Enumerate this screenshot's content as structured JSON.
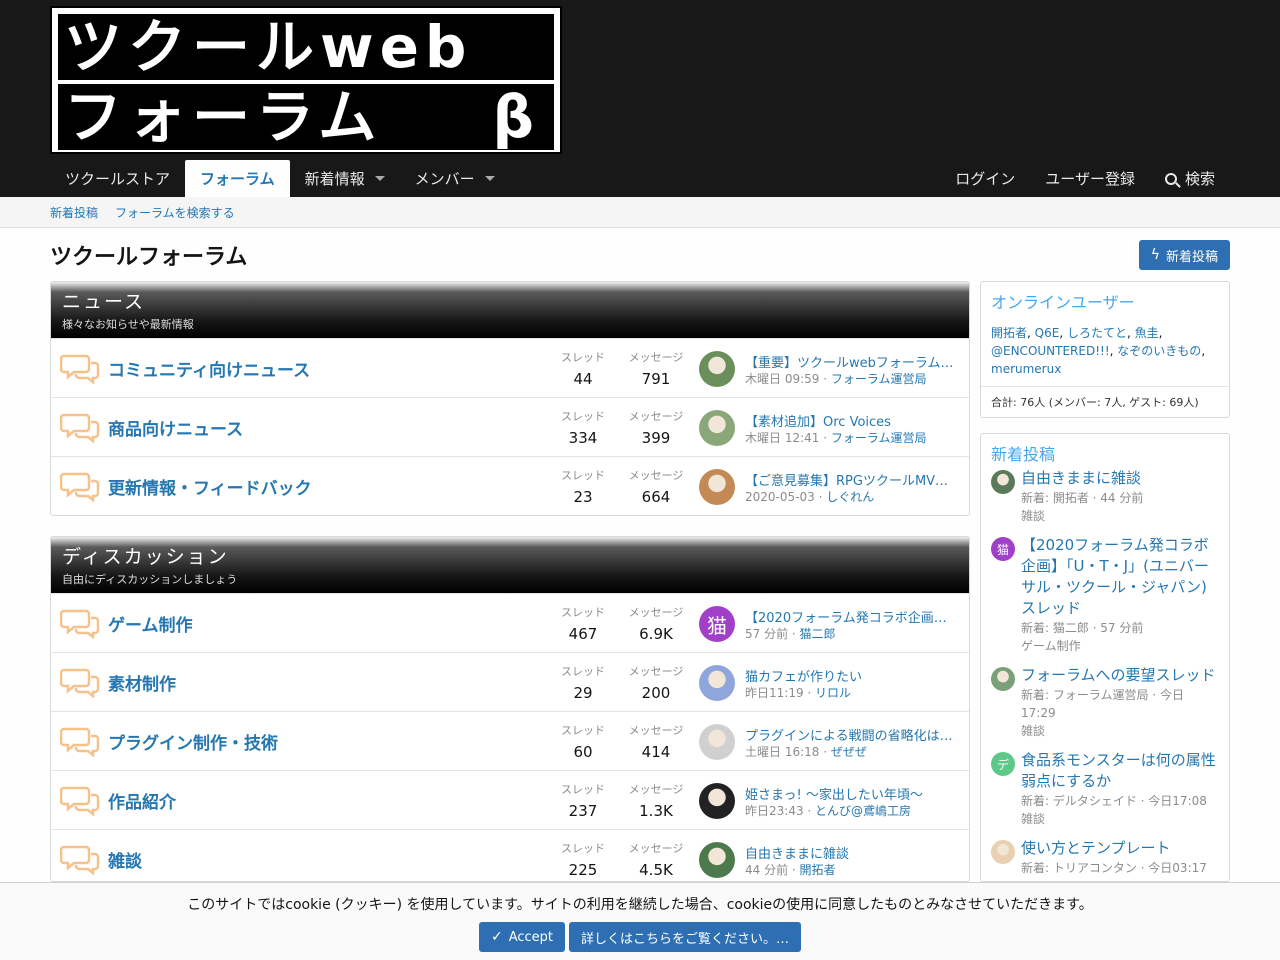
{
  "logo": {
    "line1": "ツクールweb",
    "line2": "フォーラム",
    "beta": "β"
  },
  "nav": {
    "items": [
      {
        "label": "ツクールストア"
      },
      {
        "label": "フォーラム"
      },
      {
        "label": "新着情報"
      },
      {
        "label": "メンバー"
      }
    ],
    "login": "ログイン",
    "register": "ユーザー登録",
    "search": "検索"
  },
  "subnav": {
    "new_posts": "新着投稿",
    "search_forums": "フォーラムを検索する"
  },
  "page": {
    "title": "ツクールフォーラム",
    "new_post_button": "新着投稿"
  },
  "labels": {
    "threads": "スレッド",
    "messages": "メッセージ"
  },
  "news": {
    "title": "ニュース",
    "desc": "様々なお知らせや最新情報",
    "nodes": [
      {
        "title": "コミュニティ向けニュース",
        "threads": "44",
        "messages": "791",
        "last_title": "【重要】ツクールwebフォーラムβ…",
        "last_date": "木曜日 09:59",
        "last_user": "フォーラム運営局"
      },
      {
        "title": "商品向けニュース",
        "threads": "334",
        "messages": "399",
        "last_title": "【素材追加】Orc Voices",
        "last_date": "木曜日 12:41",
        "last_user": "フォーラム運営局"
      },
      {
        "title": "更新情報・フィードバック",
        "threads": "23",
        "messages": "664",
        "last_title": "【ご意見募集】RPGツクールMV…",
        "last_date": "2020-05-03",
        "last_user": "しぐれん"
      }
    ]
  },
  "discussion": {
    "title": "ディスカッション",
    "desc": "自由にディスカッションしましょう",
    "nodes": [
      {
        "title": "ゲーム制作",
        "threads": "467",
        "messages": "6.9K",
        "last_title": "【2020フォーラム発コラボ企画】…",
        "last_date": "57 分前",
        "last_user": "猫二郎",
        "avatar_letter": "猫"
      },
      {
        "title": "素材制作",
        "threads": "29",
        "messages": "200",
        "last_title": "猫カフェが作りたい",
        "last_date": "昨日11:19",
        "last_user": "リロル"
      },
      {
        "title": "プラグイン制作・技術",
        "threads": "60",
        "messages": "414",
        "last_title": "プラグインによる戦闘の省略化は…",
        "last_date": "土曜日 16:18",
        "last_user": "ぜぜぜ"
      },
      {
        "title": "作品紹介",
        "threads": "237",
        "messages": "1.3K",
        "last_title": "姫さまっ! 〜家出したい年頃〜",
        "last_date": "昨日23:43",
        "last_user": "とんび@鳶嶋工房"
      },
      {
        "title": "雑談",
        "threads": "225",
        "messages": "4.5K",
        "last_title": "自由きままに雑談",
        "last_date": "44 分前",
        "last_user": "開拓者"
      }
    ]
  },
  "online": {
    "title": "オンラインユーザー",
    "users": [
      "開拓者",
      "Q6E",
      "しろたてと",
      "魚圭",
      "@ENCOUNTERED!!!",
      "なぞのいきもの",
      "merumerux"
    ],
    "total": "合計: 76人 (メンバー: 7人, ゲスト: 69人)"
  },
  "new_posts": {
    "title": "新着投稿",
    "items": [
      {
        "title": "自由きままに雑談",
        "meta": "新着: 開拓者 · 44 分前",
        "forum": "雑談"
      },
      {
        "title": "【2020フォーラム発コラボ企画】「U・T・J」(ユニバーサル・ツクール・ジャパン) スレッド",
        "meta": "新着: 猫二郎 · 57 分前",
        "forum": "ゲーム制作",
        "avatar_letter": "猫"
      },
      {
        "title": "フォーラムへの要望スレッド",
        "meta": "新着: フォーラム運営局 · 今日 17:29",
        "forum": "雑談"
      },
      {
        "title": "食品系モンスターは何の属性弱点にするか",
        "meta": "新着: デルタシェイド · 今日17:08",
        "forum": "雑談",
        "avatar_letter": "デ"
      },
      {
        "title": "使い方とテンプレート",
        "meta": "新着: トリアコンタン · 今日03:17",
        "forum": ""
      }
    ]
  },
  "cookie": {
    "text": "このサイトではcookie (クッキー) を使用しています。サイトの利用を継続した場合、cookieの使用に同意したものとみなさせていただきます。",
    "accept": "Accept",
    "more": "詳しくはこちらをご覧ください。…"
  },
  "colors": {
    "link": "#2577b1",
    "button": "#2d6fb2",
    "header_bg": "#181818",
    "sidebar_title": "#47a7eb",
    "node_icon": "#f6c18a"
  }
}
